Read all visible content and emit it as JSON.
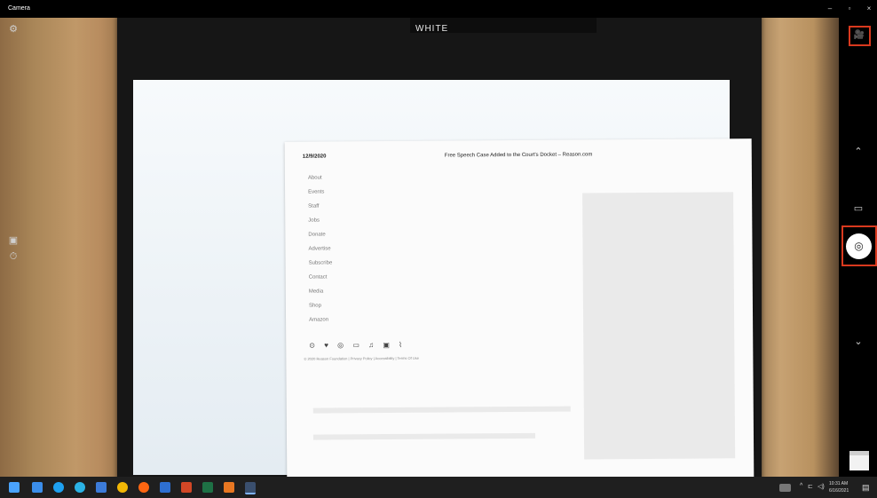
{
  "window": {
    "title": "Camera"
  },
  "camera_view": {
    "tablet_label": "WHITE",
    "paper": {
      "date": "12/9/2020",
      "title": "Free Speech Case Added to the Court's Docket – Reason.com",
      "menu_items": [
        "About",
        "Events",
        "Staff",
        "Jobs",
        "Donate",
        "Advertise",
        "Subscribe",
        "Contact",
        "Media",
        "Shop",
        "Amazon"
      ],
      "social_row": "⊙ ♥ ◎ ▭ ♫ ▣ ⌇",
      "footer": "© 2020 Reason Foundation | Privacy Policy | Accessibility | Terms Of Use"
    }
  },
  "left_sidebar": {
    "settings_icon": "⚙",
    "hdr_icon": "▣",
    "timer_icon": "⏱"
  },
  "right_sidebar": {
    "video_mode_icon": "🎥",
    "up_icon": "⌃",
    "photo_mode_icon": "▭",
    "capture_icon": "◎",
    "down_icon": "⌄"
  },
  "taskbar": {
    "time": "10:31 AM",
    "date": "6/16/2021",
    "tray_chevron": "^",
    "notification_icon": "▤"
  },
  "colors": {
    "highlight": "#d9391e",
    "taskbar": "#1f1f1f"
  }
}
